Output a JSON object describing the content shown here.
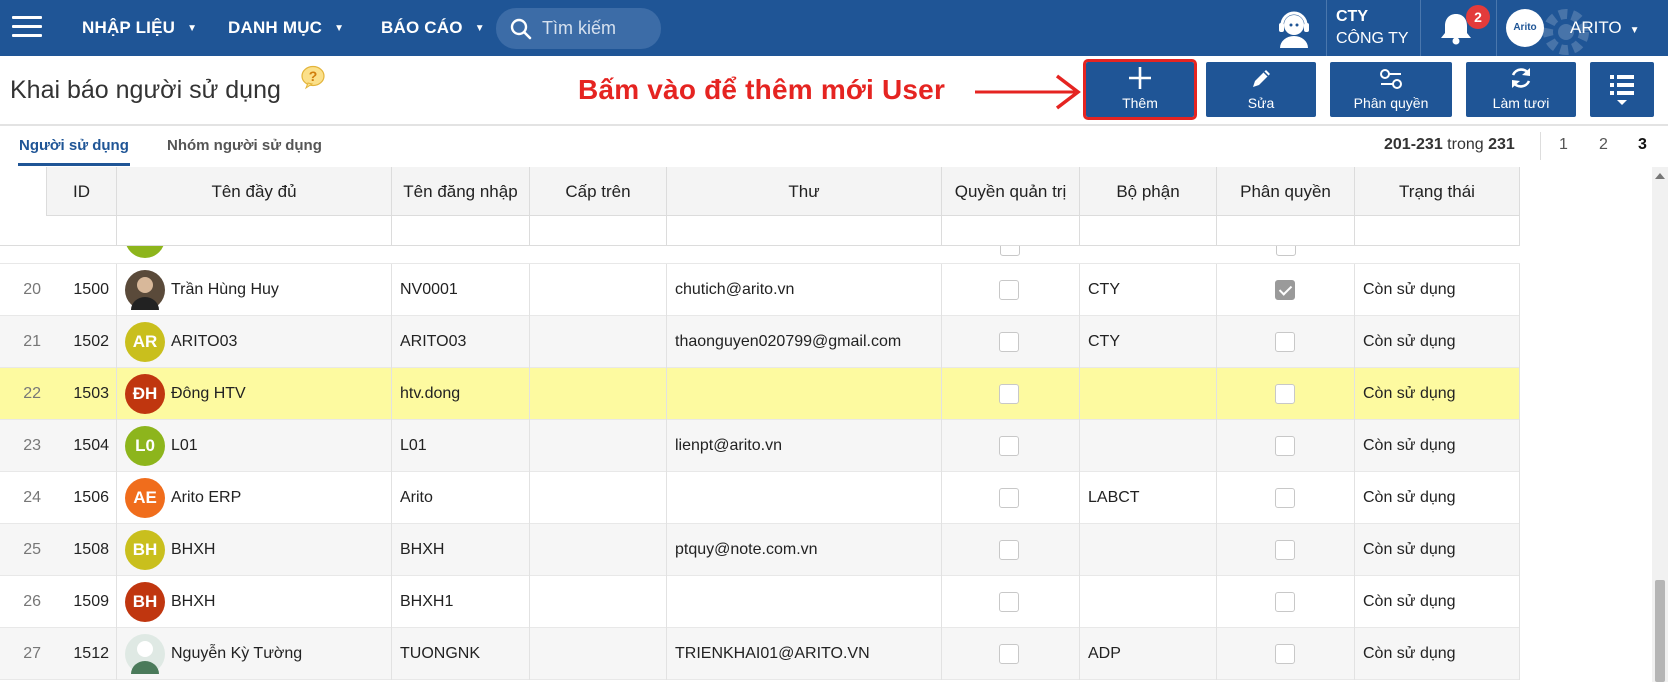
{
  "navbar": {
    "menu": [
      {
        "label": "NHẬP LIỆU"
      },
      {
        "label": "DANH MỤC"
      },
      {
        "label": "BÁO CÁO"
      }
    ],
    "search_placeholder": "Tìm kiếm",
    "company_code": "CTY",
    "company_name": "CÔNG TY",
    "notification_count": "2",
    "avatar_text": "Arito",
    "user_name": "ARITO"
  },
  "page": {
    "title": "Khai báo người sử dụng",
    "help_mark": "?",
    "annotation": "Bấm vào để thêm mới User"
  },
  "toolbar": {
    "add_label": "Thêm",
    "edit_label": "Sửa",
    "permission_label": "Phân quyền",
    "refresh_label": "Làm tươi"
  },
  "tabs": [
    {
      "label": "Người sử dụng",
      "active": true
    },
    {
      "label": "Nhóm người sử dụng",
      "active": false
    }
  ],
  "pager": {
    "range": "201-231",
    "word": "trong",
    "total": "231",
    "pages": [
      "1",
      "2",
      "3"
    ],
    "current": "3"
  },
  "table": {
    "columns": [
      "ID",
      "Tên đầy đủ",
      "Tên đăng nhập",
      "Cấp trên",
      "Thư",
      "Quyền quản trị",
      "Bộ phận",
      "Phân quyền",
      "Trạng thái"
    ],
    "rows": [
      {
        "num": "20",
        "id": "1500",
        "initials": "",
        "avatar_color": "#5a4a3a",
        "photo": true,
        "name": "Trần Hùng Huy",
        "login": "NV0001",
        "manager": "",
        "email": "chutich@arito.vn",
        "admin": false,
        "dept": "CTY",
        "perm": true,
        "status": "Còn sử dụng"
      },
      {
        "num": "21",
        "id": "1502",
        "initials": "AR",
        "avatar_color": "#c9bf1d",
        "photo": false,
        "name": "ARITO03",
        "login": "ARITO03",
        "manager": "",
        "email": "thaonguyen020799@gmail.com",
        "admin": false,
        "dept": "CTY",
        "perm": false,
        "status": "Còn sử dụng"
      },
      {
        "num": "22",
        "id": "1503",
        "initials": "ĐH",
        "avatar_color": "#c0360f",
        "photo": false,
        "name": "Đông HTV",
        "login": "htv.dong",
        "manager": "",
        "email": "",
        "admin": false,
        "dept": "",
        "perm": false,
        "status": "Còn sử dụng"
      },
      {
        "num": "23",
        "id": "1504",
        "initials": "L0",
        "avatar_color": "#8db51c",
        "photo": false,
        "name": "L01",
        "login": "L01",
        "manager": "",
        "email": "lienpt@arito.vn",
        "admin": false,
        "dept": "",
        "perm": false,
        "status": "Còn sử dụng"
      },
      {
        "num": "24",
        "id": "1506",
        "initials": "AE",
        "avatar_color": "#f06d1c",
        "photo": false,
        "name": "Arito ERP",
        "login": "Arito",
        "manager": "",
        "email": "",
        "admin": false,
        "dept": "LABCT",
        "perm": false,
        "status": "Còn sử dụng"
      },
      {
        "num": "25",
        "id": "1508",
        "initials": "BH",
        "avatar_color": "#c9bf1d",
        "photo": false,
        "name": "BHXH",
        "login": "BHXH",
        "manager": "",
        "email": "ptquy@note.com.vn",
        "admin": false,
        "dept": "",
        "perm": false,
        "status": "Còn sử dụng"
      },
      {
        "num": "26",
        "id": "1509",
        "initials": "BH",
        "avatar_color": "#c0360f",
        "photo": false,
        "name": "BHXH",
        "login": "BHXH1",
        "manager": "",
        "email": "",
        "admin": false,
        "dept": "",
        "perm": false,
        "status": "Còn sử dụng"
      },
      {
        "num": "27",
        "id": "1512",
        "initials": "",
        "avatar_color": "#dfe9e4",
        "photo": true,
        "name": "Nguyễn Kỳ Tường",
        "login": "TUONGNK",
        "manager": "",
        "email": "TRIENKHAI01@ARITO.VN",
        "admin": false,
        "dept": "ADP",
        "perm": false,
        "status": "Còn sử dụng"
      }
    ],
    "selected_row": "22",
    "partial_row_color": "#8db51c"
  }
}
